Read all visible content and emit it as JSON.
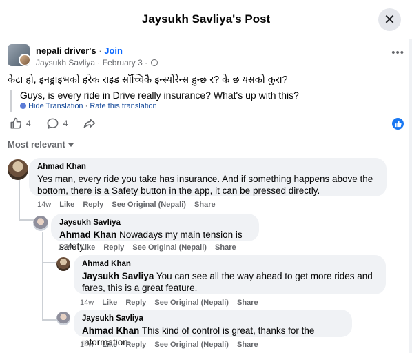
{
  "header": {
    "title": "Jaysukh Savliya's Post",
    "close_glyph": "✕"
  },
  "post": {
    "group_name": "nepali driver's",
    "join_label": "Join",
    "author": "Jaysukh Savliya",
    "date": "February 3",
    "text": "केटा हो, इनड्राइभको हरेक राइड साँच्चिकै इन्स्योरेन्स हुन्छ र? के छ यसको कुरा?",
    "translation": "Guys, is every ride in Drive really insurance? What's up with this?",
    "hide_translation": "Hide Translation",
    "rate_translation": "Rate this translation",
    "like_count": "4",
    "comment_count": "4",
    "sort_label": "Most relevant"
  },
  "comments": [
    {
      "author": "Ahmad Khan",
      "tag": "",
      "text": "Yes man, every ride you take has insurance. And if something happens above the bottom, there is a Safety button in the app, it can be pressed directly.",
      "time": "14w",
      "like": "Like",
      "reply": "Reply",
      "see_original": "See Original (Nepali)",
      "share": "Share"
    },
    {
      "author": "Jaysukh Savliya",
      "tag": "Ahmad Khan",
      "text": " Nowadays my main tension is safety",
      "time": "14w",
      "like": "Like",
      "reply": "Reply",
      "see_original": "See Original (Nepali)",
      "share": "Share"
    },
    {
      "author": "Ahmad Khan",
      "tag": "Jaysukh Savliya",
      "text": " You can see all the way ahead to get more rides and fares, this is a great feature.",
      "time": "14w",
      "like": "Like",
      "reply": "Reply",
      "see_original": "See Original (Nepali)",
      "share": "Share"
    },
    {
      "author": "Jaysukh Savliya",
      "tag": "Ahmad Khan",
      "text": " This kind of control is great, thanks for the information",
      "time": "14w",
      "like": "Like",
      "reply": "Reply",
      "see_original": "See Original (Nepali)",
      "share": "Share"
    }
  ],
  "colors": {
    "link": "#0866ff",
    "like_badge": "#1877f2",
    "bubble": "#f0f2f5",
    "muted": "#65676b"
  }
}
